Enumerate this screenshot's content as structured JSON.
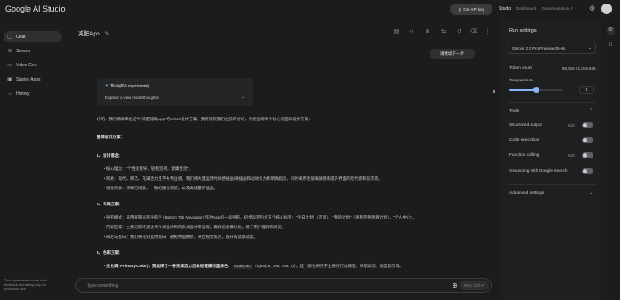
{
  "app": {
    "title": "Google AI Studio",
    "get_api_key": "Get API key",
    "nav": {
      "studio": "Studio",
      "dashboard": "Dashboard",
      "documentation": "Documentation"
    }
  },
  "sidebar": {
    "items": [
      {
        "label": "Chat",
        "icon": "chat-icon"
      },
      {
        "label": "Stream",
        "icon": "stream-icon"
      },
      {
        "label": "Video Gen",
        "icon": "video-icon"
      },
      {
        "label": "Starter Apps",
        "icon": "apps-icon"
      },
      {
        "label": "History",
        "icon": "history-icon"
      }
    ],
    "note": "This experimental model is for feedback and testing only. No production use."
  },
  "main": {
    "title": "减肥App",
    "user_message": "请继续下一步",
    "thoughts": {
      "title": "Thoughts",
      "tag": "(experimental)",
      "expand": "Expand to view model thoughts"
    },
    "lines": [
      "好的，我们继续细化这个\"减肥辅助App\"的UI/UX设计方案。我将按照我们之前的讨论，为您呈现每个核心页面的设计方案：",
      "整体设计方案：",
      "1、设计概念：",
      "核心理念：\"个性化指导，轻松坚持，健康生活\"。",
      "风格：现代、简洁、充满活力且不失专业感。我们将大量运用时尚感插画/微插画和动效引力和明确指引，同时采用毛玻璃质感来提升界面的现代感和层次感。",
      "视觉元素：清晰的排版，一致的图标系统，以及高质量的插画。",
      "2、布局方案：",
      "导航模式：采用底部标签导航栏 (Bottom Tab Navigator) 作为App的一级导航。初步设定包含五个核心标签：\"今日计划\"（首页）、\"我的计划\"（查看完整周期计划）、\"个人中心\"。",
      "内容区域：主要内容将通过卡片式设计和列表式设计来呈现，确保信息模块化，易于用户理解和浏览。",
      "间距与留白：我们将充分运用留白，避免界面拥挤，突出视觉焦点，提升阅读舒适度。",
      "3、色彩方案：",
      "主色调 (Primary Color)：我选择了一种充满活力且象征健康的蓝绿色：",
      "#1abc9c",
      "（rgba(26, 188, 156, 1)）。这个颜色将用于主要的行动按钮、导航高亮、进度指示等。"
    ],
    "input_placeholder": "Type something",
    "run_label": "Run",
    "run_shortcut": "Ctrl ↵"
  },
  "run_settings": {
    "title": "Run settings",
    "model": "Gemini 2.5 Pro Preview 05-06",
    "token_count_label": "Token count",
    "token_count_value": "85,516 / 1,048,576",
    "temperature_label": "Temperature",
    "temperature_value": "1",
    "temperature_fraction": 0.5,
    "tools_label": "Tools",
    "tools": [
      {
        "label": "Structured output",
        "edit": "Edit"
      },
      {
        "label": "Code execution",
        "edit": ""
      },
      {
        "label": "Function calling",
        "edit": "Edit"
      },
      {
        "label": "Grounding with Google Search",
        "edit": ""
      }
    ],
    "advanced_label": "Advanced settings"
  }
}
